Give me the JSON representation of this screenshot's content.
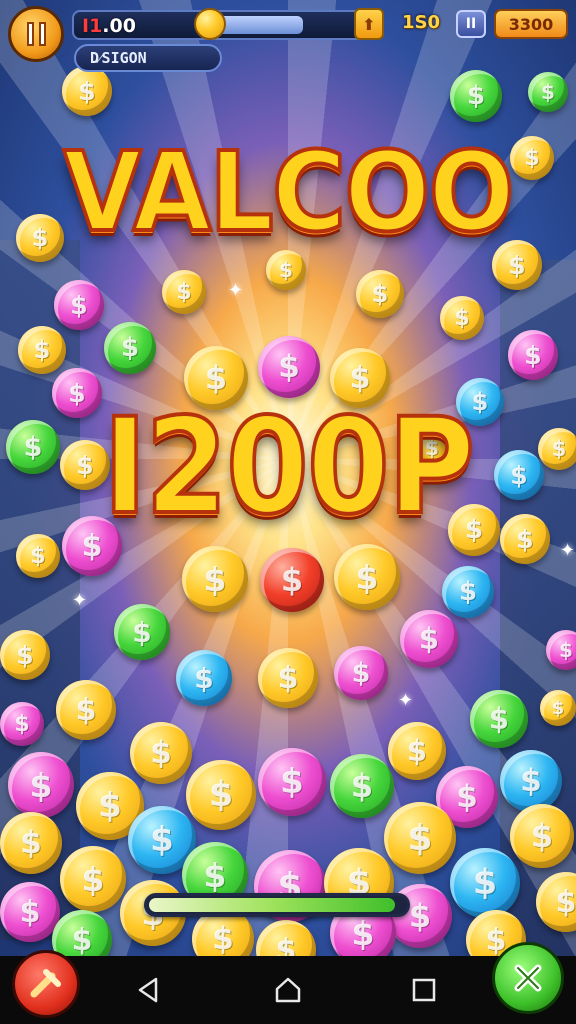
{
  "hud": {
    "score_prefix": "I1",
    "score_value": ".00",
    "division_label": "D⁄SIGON",
    "multiplier": "1S0",
    "pause_label": "II",
    "total": "3300",
    "bar_badge_icon": "up-arrow-icon",
    "bar_fill_fraction": 0.65
  },
  "banner": {
    "title": "VALCOO",
    "amount": "I200P"
  },
  "progress": {
    "fraction": 0.96
  },
  "colors": {
    "title_fill": "#ffd21e",
    "title_outline": "#b5320c",
    "back_button": "#e2301e",
    "close_button": "#3ec12a"
  },
  "nav": {
    "back_icon": "triangle-back-icon",
    "home_icon": "home-icon",
    "recents_icon": "square-recents-icon"
  }
}
